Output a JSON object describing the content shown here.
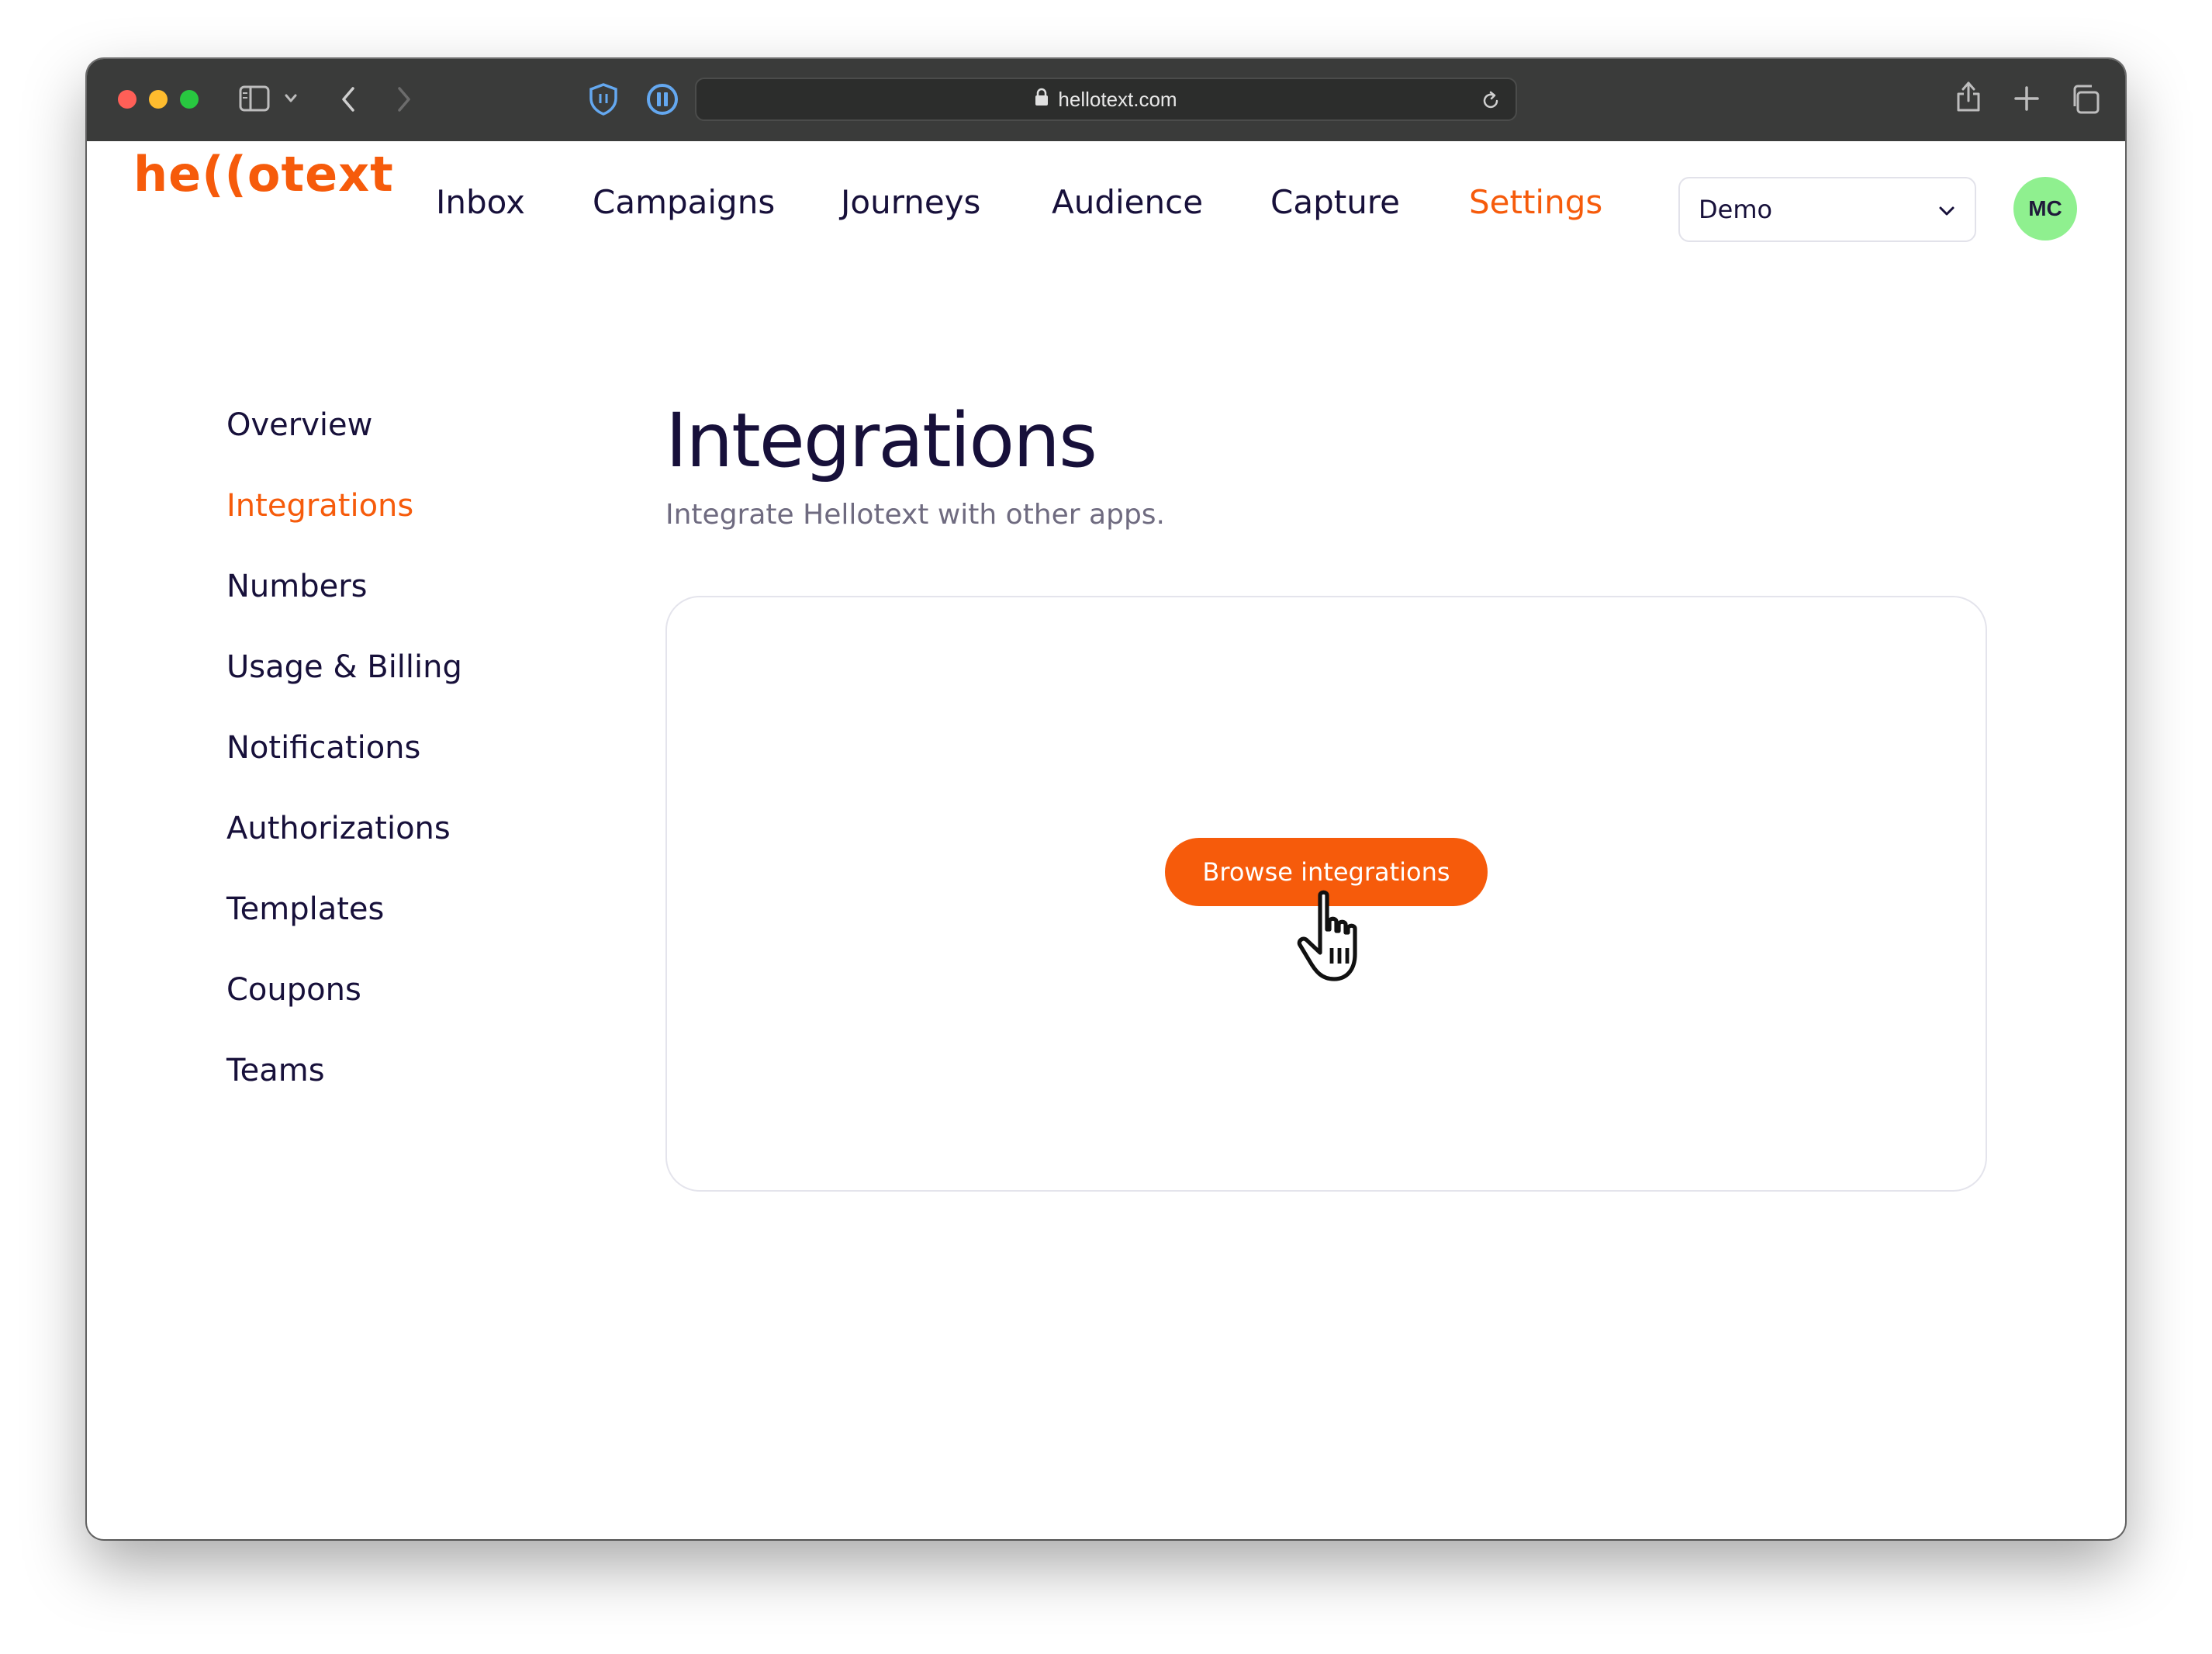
{
  "browser": {
    "url": "hellotext.com"
  },
  "app": {
    "logo_text": "he((otext",
    "nav": [
      {
        "label": "Inbox"
      },
      {
        "label": "Campaigns"
      },
      {
        "label": "Journeys"
      },
      {
        "label": "Audience"
      },
      {
        "label": "Capture"
      },
      {
        "label": "Settings",
        "active": true
      }
    ],
    "org_select": {
      "value": "Demo"
    },
    "avatar_initials": "MC"
  },
  "sidebar": {
    "items": [
      {
        "label": "Overview"
      },
      {
        "label": "Integrations",
        "active": true
      },
      {
        "label": "Numbers"
      },
      {
        "label": "Usage & Billing"
      },
      {
        "label": "Notifications"
      },
      {
        "label": "Authorizations"
      },
      {
        "label": "Templates"
      },
      {
        "label": "Coupons"
      },
      {
        "label": "Teams"
      }
    ]
  },
  "main": {
    "title": "Integrations",
    "subtitle": "Integrate Hellotext with other apps.",
    "browse_button_label": "Browse integrations"
  },
  "colors": {
    "accent": "#f65b0b",
    "text_primary": "#17103a",
    "avatar_bg": "#8ff08f",
    "titlebar_bg": "#3a3b3a"
  },
  "icons": {
    "window_controls": [
      "close-dot",
      "minimize-dot",
      "zoom-dot"
    ],
    "toolbar_left": [
      "sidebar-icon",
      "chevron-down-icon",
      "back-arrow-icon",
      "forward-arrow-icon"
    ],
    "extensions": [
      "shield-icon",
      "pause-icon"
    ],
    "urlbar": [
      "lock-icon",
      "reload-icon"
    ],
    "toolbar_right": [
      "share-icon",
      "new-tab-icon",
      "tabs-overview-icon"
    ],
    "cursor": "hand-pointer-cursor"
  }
}
